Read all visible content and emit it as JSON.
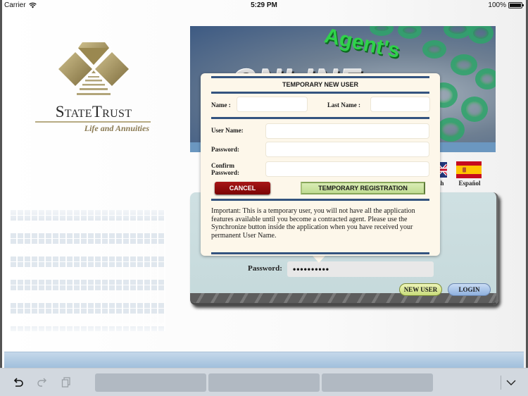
{
  "status_bar": {
    "carrier": "Carrier",
    "time": "5:29 PM",
    "battery": "100%",
    "battery_level": 1.0,
    "icons": [
      "wifi-icon",
      "battery-icon"
    ]
  },
  "brand": {
    "name": "StateTrust",
    "tagline": "Life and Annuities",
    "colors": {
      "gold": "#8a7a52",
      "text": "#2b2b2b"
    }
  },
  "banner": {
    "line1": "Agent's",
    "line2": "ONLINE"
  },
  "languages": [
    {
      "label": "English",
      "visible_label": "sh",
      "icon": "uk-flag-icon"
    },
    {
      "label": "Español",
      "icon": "spain-flag-icon"
    }
  ],
  "login": {
    "password_label": "Password:",
    "password_value": "••••••••••",
    "new_user_label": "NEW USER",
    "login_label": "LOGIN"
  },
  "modal": {
    "title": "TEMPORARY NEW USER",
    "name_label": "Name :",
    "name_value": "",
    "last_name_label": "Last Name :",
    "last_name_value": "",
    "username_label": "User Name:",
    "username_value": "",
    "password_label": "Password:",
    "password_value": "",
    "confirm_label_1": "Confirm",
    "confirm_label_2": "Password:",
    "confirm_value": "",
    "cancel_label": "CANCEL",
    "register_label": "TEMPORARY REGISTRATION",
    "notice": "Important: This is a temporary user, you will not have all the application features available until you become a contracted agent. Please use the Synchronize button inside the application when you have received your permanent User Name.",
    "colors": {
      "rule": "#34547f",
      "cancel": "#8e0c0c",
      "register": "#c8e09c",
      "background": "#fdf7ea"
    }
  },
  "keyboard_toolbar": {
    "icons": [
      "undo-icon",
      "redo-icon",
      "paste-icon",
      "chevron-down-icon"
    ],
    "suggestions": [
      "",
      "",
      ""
    ]
  }
}
